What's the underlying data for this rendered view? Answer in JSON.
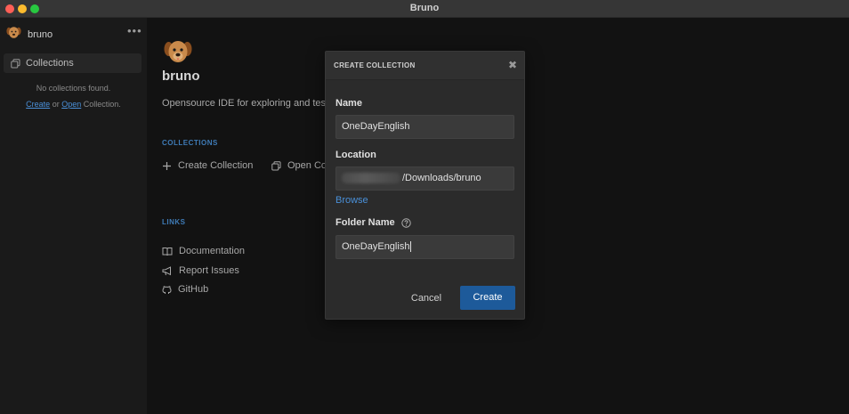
{
  "window": {
    "title": "Bruno"
  },
  "sidebar": {
    "brand": "bruno",
    "more": "•••",
    "collections_label": "Collections",
    "empty_text": "No collections found.",
    "create_link": "Create",
    "or_text": "or",
    "open_link": "Open",
    "collection_suffix": "Collection."
  },
  "welcome": {
    "name": "bruno",
    "tagline": "Opensource IDE for exploring and tes",
    "collections_heading": "COLLECTIONS",
    "create_collection": "Create Collection",
    "open_collection": "Open Co",
    "links_heading": "LINKS",
    "documentation": "Documentation",
    "report_issues": "Report Issues",
    "github": "GitHub"
  },
  "modal": {
    "title": "CREATE COLLECTION",
    "close": "✖",
    "name_label": "Name",
    "name_value": "OneDayEnglish",
    "location_label": "Location",
    "location_value": "/Downloads/bruno",
    "browse": "Browse",
    "folder_label": "Folder Name",
    "folder_value": "OneDayEnglish",
    "cancel": "Cancel",
    "create": "Create"
  },
  "colors": {
    "accent": "#1d5a9a",
    "link": "#4a90d9",
    "section_label": "#3f7cb8"
  }
}
